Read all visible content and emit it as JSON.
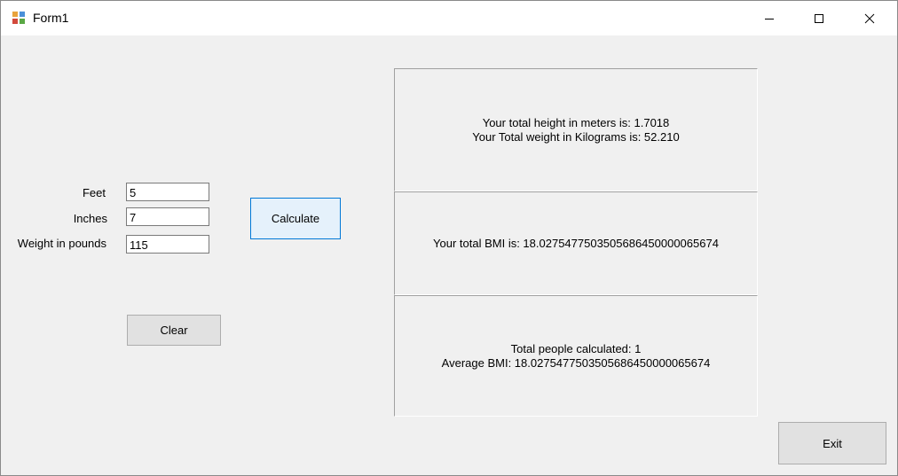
{
  "window": {
    "title": "Form1",
    "icons": [
      "app-icon",
      "minimize-icon",
      "maximize-icon",
      "close-icon"
    ]
  },
  "form": {
    "feet_label": "Feet",
    "feet_value": "5",
    "inches_label": "Inches",
    "inches_value": "7",
    "weight_label": "Weight in pounds",
    "weight_value": "115",
    "calculate_label": "Calculate",
    "clear_label": "Clear",
    "exit_label": "Exit"
  },
  "results": {
    "height_text": "Your total height in meters is: 1.7018",
    "weight_text": "Your Total weight in Kilograms is: 52.210",
    "bmi_text": "Your total BMI is: 18.0275477503505686450000065674",
    "people_text": "Total people calculated: 1",
    "avg_text": "Average BMI: 18.0275477503505686450000065674"
  },
  "colors": {
    "window_bg": "#f0f0f0",
    "titlebar_bg": "#ffffff",
    "button_bg": "#e1e1e1",
    "focus_border": "#0078d7"
  }
}
